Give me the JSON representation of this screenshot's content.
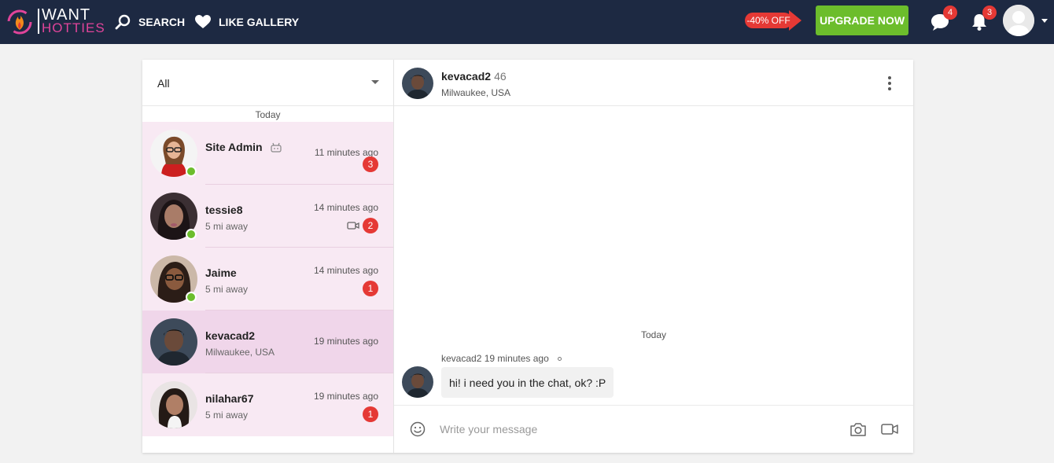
{
  "brand": {
    "line1": "WANT",
    "line2": "HOTTIES"
  },
  "nav": {
    "search_label": "SEARCH",
    "like_gallery_label": "LIKE GALLERY",
    "promo_label": "-40% OFF",
    "upgrade_label": "UPGRADE NOW",
    "messages_badge": "4",
    "notifications_badge": "3"
  },
  "filter": {
    "selected": "All"
  },
  "conversations": {
    "day_label": "Today",
    "items": [
      {
        "name": "Site Admin",
        "subtitle": "",
        "time": "11 minutes ago",
        "unread": "3"
      },
      {
        "name": "tessie8",
        "subtitle": "5 mi away",
        "time": "14 minutes ago",
        "unread": "2"
      },
      {
        "name": "Jaime",
        "subtitle": "5 mi away",
        "time": "14 minutes ago",
        "unread": "1"
      },
      {
        "name": "kevacad2",
        "subtitle": "Milwaukee, USA",
        "time": "19 minutes ago",
        "unread": ""
      },
      {
        "name": "nilahar67",
        "subtitle": "5 mi away",
        "time": "19 minutes ago",
        "unread": "1"
      }
    ]
  },
  "chat": {
    "name": "kevacad2",
    "age": "46",
    "location": "Milwaukee, USA",
    "day_label": "Today",
    "messages": [
      {
        "sender": "kevacad2",
        "time": "19 minutes ago",
        "text": "hi! i need you in the chat, ok? :P"
      }
    ],
    "input_placeholder": "Write your message"
  },
  "colors": {
    "topbar": "#1d2942",
    "upgrade": "#6cbd2c",
    "badge": "#e53935",
    "conversation_bg": "#f8e9f3",
    "conversation_active_bg": "#f0d6ea"
  }
}
